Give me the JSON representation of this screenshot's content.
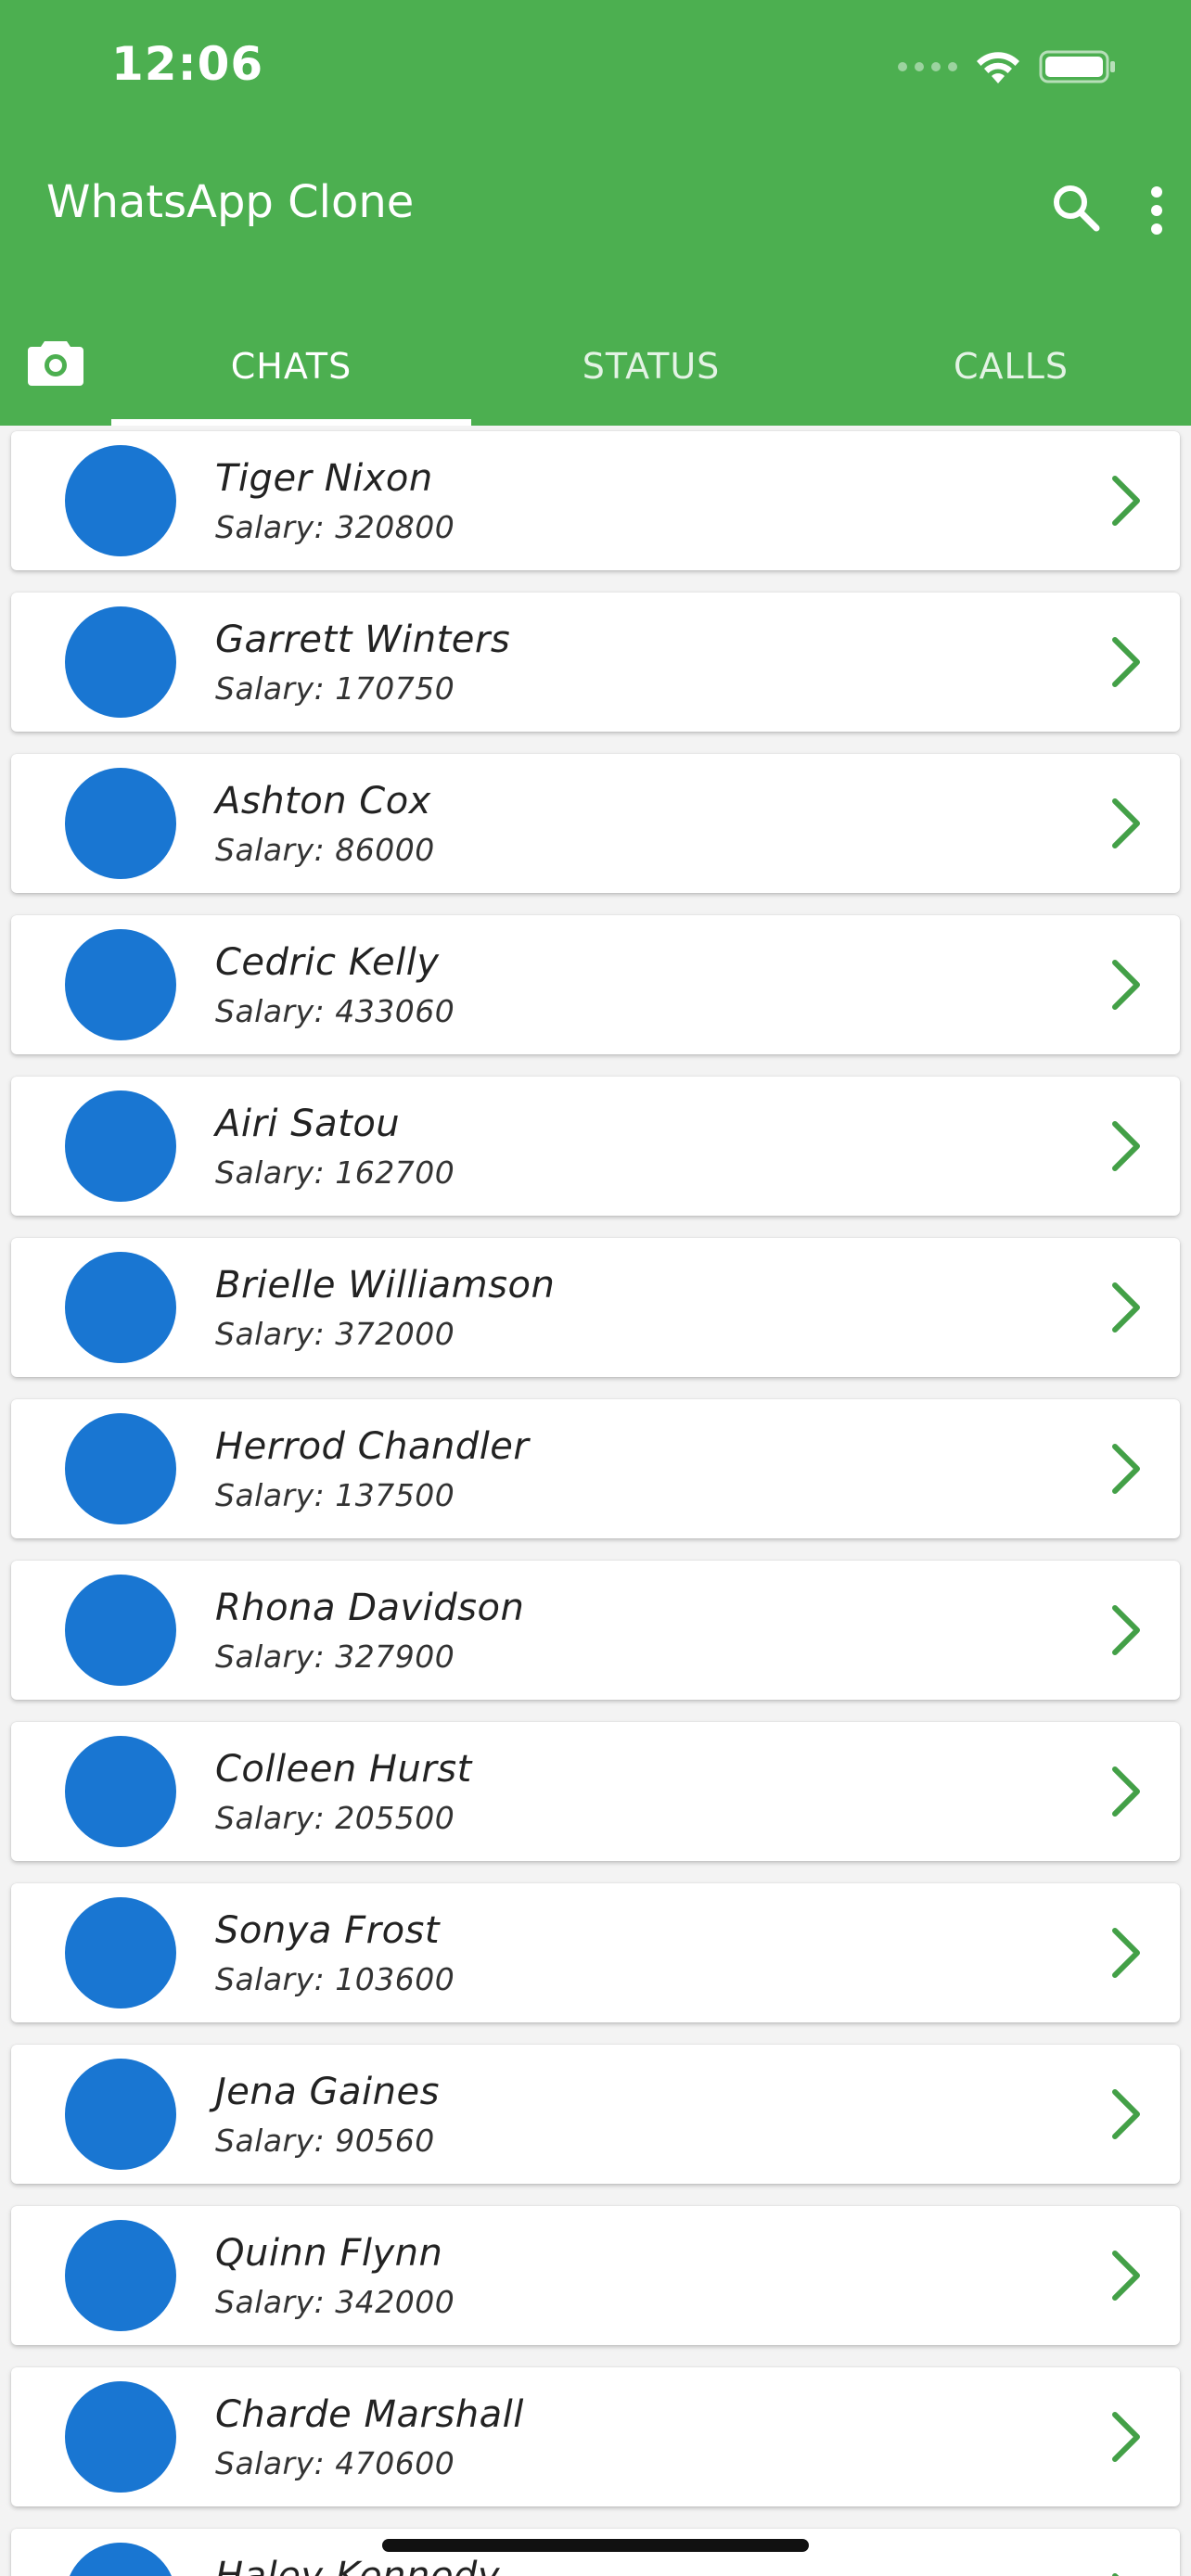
{
  "status_bar": {
    "time": "12:06"
  },
  "app_bar": {
    "title": "WhatsApp Clone",
    "icons": [
      "search-icon",
      "more-vert-icon"
    ]
  },
  "tabs": {
    "camera_icon": "camera-icon",
    "items": [
      {
        "label": "CHATS",
        "active": true
      },
      {
        "label": "STATUS",
        "active": false
      },
      {
        "label": "CALLS",
        "active": false
      }
    ]
  },
  "colors": {
    "app_bar": "#4caf50",
    "avatar": "#1976d2",
    "chevron": "#43a047"
  },
  "chats": [
    {
      "name": "Tiger Nixon",
      "salary": "Salary: 320800"
    },
    {
      "name": "Garrett Winters",
      "salary": "Salary: 170750"
    },
    {
      "name": "Ashton Cox",
      "salary": "Salary: 86000"
    },
    {
      "name": "Cedric Kelly",
      "salary": "Salary: 433060"
    },
    {
      "name": "Airi Satou",
      "salary": "Salary: 162700"
    },
    {
      "name": "Brielle Williamson",
      "salary": "Salary: 372000"
    },
    {
      "name": "Herrod Chandler",
      "salary": "Salary: 137500"
    },
    {
      "name": "Rhona Davidson",
      "salary": "Salary: 327900"
    },
    {
      "name": "Colleen Hurst",
      "salary": "Salary: 205500"
    },
    {
      "name": "Sonya Frost",
      "salary": "Salary: 103600"
    },
    {
      "name": "Jena Gaines",
      "salary": "Salary: 90560"
    },
    {
      "name": "Quinn Flynn",
      "salary": "Salary: 342000"
    },
    {
      "name": "Charde Marshall",
      "salary": "Salary: 470600"
    },
    {
      "name": "Haley Kennedy",
      "salary": ""
    }
  ]
}
